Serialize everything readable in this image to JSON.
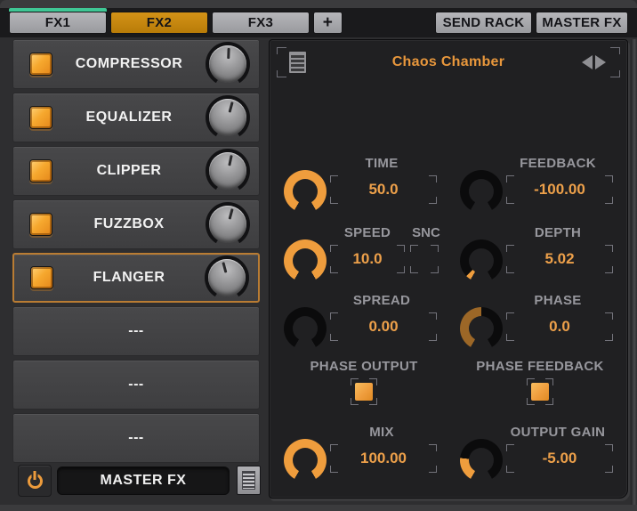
{
  "tab_bar": {
    "tabs": [
      {
        "label": "FX1",
        "state": "indicator"
      },
      {
        "label": "FX2",
        "state": "selected"
      },
      {
        "label": "FX3",
        "state": "normal"
      }
    ],
    "add_button": "+",
    "send_rack_label": "SEND RACK",
    "master_fx_label": "MASTER FX"
  },
  "fx_rack": {
    "slots": [
      {
        "label": "COMPRESSOR",
        "enabled": true,
        "knob_angle": 2
      },
      {
        "label": "EQUALIZER",
        "enabled": true,
        "knob_angle": 15
      },
      {
        "label": "CLIPPER",
        "enabled": true,
        "knob_angle": 12
      },
      {
        "label": "FUZZBOX",
        "enabled": true,
        "knob_angle": 15
      },
      {
        "label": "FLANGER",
        "enabled": true,
        "knob_angle": -15,
        "selected": true
      },
      {
        "label": "---",
        "empty": true
      },
      {
        "label": "---",
        "empty": true
      },
      {
        "label": "---",
        "empty": true
      }
    ],
    "footer": {
      "routing": "MASTER FX"
    }
  },
  "panel": {
    "title": "Chaos Chamber",
    "rows": {
      "r1": {
        "left": {
          "label": "TIME",
          "value": "50.0",
          "knob": {
            "fill": 1,
            "color": "#ef9d3d"
          }
        },
        "right": {
          "label": "FEEDBACK",
          "value": "-100.00",
          "knob": {
            "fill": 0,
            "color": "#ef9d3d"
          }
        }
      },
      "r2": {
        "left": {
          "label": "SPEED",
          "sync_label": "SNC",
          "sync_checked": false,
          "value": "10.0",
          "knob": {
            "fill": 1,
            "color": "#ef9d3d"
          }
        },
        "right": {
          "label": "DEPTH",
          "value": "5.02",
          "knob": {
            "fill": 0.05,
            "color": "#ef9d3d"
          }
        }
      },
      "r3": {
        "left": {
          "label": "SPREAD",
          "value": "0.00",
          "knob": {
            "fill": 0,
            "color": "#ef9d3d"
          }
        },
        "right": {
          "label": "PHASE",
          "value": "0.0",
          "knob": {
            "fill": 0.5,
            "color": "#9c6727"
          }
        }
      },
      "r4": {
        "left": {
          "label": "PHASE OUTPUT",
          "checked": true
        },
        "right": {
          "label": "PHASE FEEDBACK",
          "checked": true
        }
      },
      "r5": {
        "left": {
          "label": "MIX",
          "value": "100.00",
          "knob": {
            "fill": 1,
            "color": "#ef9d3d"
          }
        },
        "right": {
          "label": "OUTPUT GAIN",
          "value": "-5.00",
          "knob": {
            "fill": 0.22,
            "color": "#ef9d3d"
          }
        }
      }
    }
  },
  "colors": {
    "accent_orange": "#e8973c",
    "tab_orange": "#c8860d",
    "indicator_green": "#3fc795",
    "knob_dark": "#0b0b0c"
  }
}
